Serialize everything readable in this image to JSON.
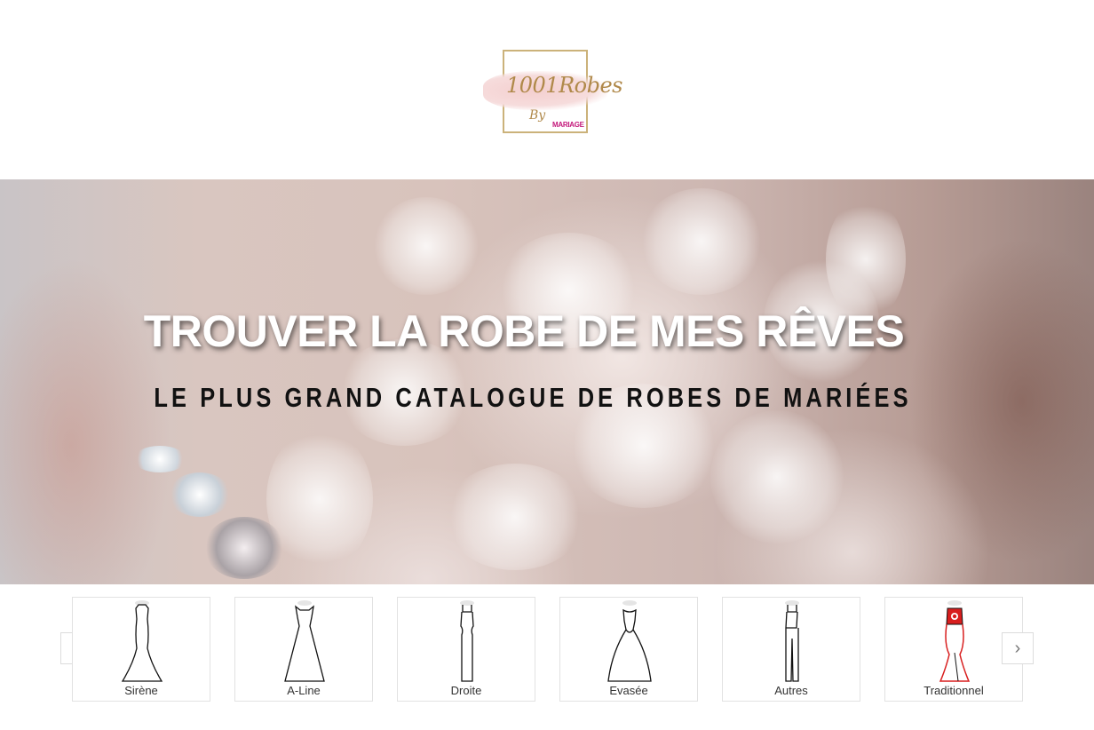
{
  "header": {
    "logo": {
      "main_text": "1001Robes",
      "by_text": "By",
      "sub_brand": "MARIAGE",
      "colors": {
        "gold": "#b0894a",
        "brush": "#f4cfcf",
        "brand_pink": "#c3187a"
      }
    }
  },
  "hero": {
    "title": "TROUVER LA ROBE DE MES RÊVES",
    "subtitle": "LE PLUS GRAND CATALOGUE DE ROBES DE MARIÉES"
  },
  "carousel": {
    "prev_icon": "chevron-left-icon",
    "next_icon": "chevron-right-icon",
    "categories": [
      {
        "label": "Sirène",
        "icon": "mermaid-dress-icon"
      },
      {
        "label": "A-Line",
        "icon": "a-line-dress-icon"
      },
      {
        "label": "Droite",
        "icon": "straight-dress-icon"
      },
      {
        "label": "Evasée",
        "icon": "ball-gown-dress-icon"
      },
      {
        "label": "Autres",
        "icon": "jumpsuit-icon"
      },
      {
        "label": "Traditionnel",
        "icon": "traditional-dress-icon",
        "accent": "#d81e1e"
      }
    ]
  }
}
